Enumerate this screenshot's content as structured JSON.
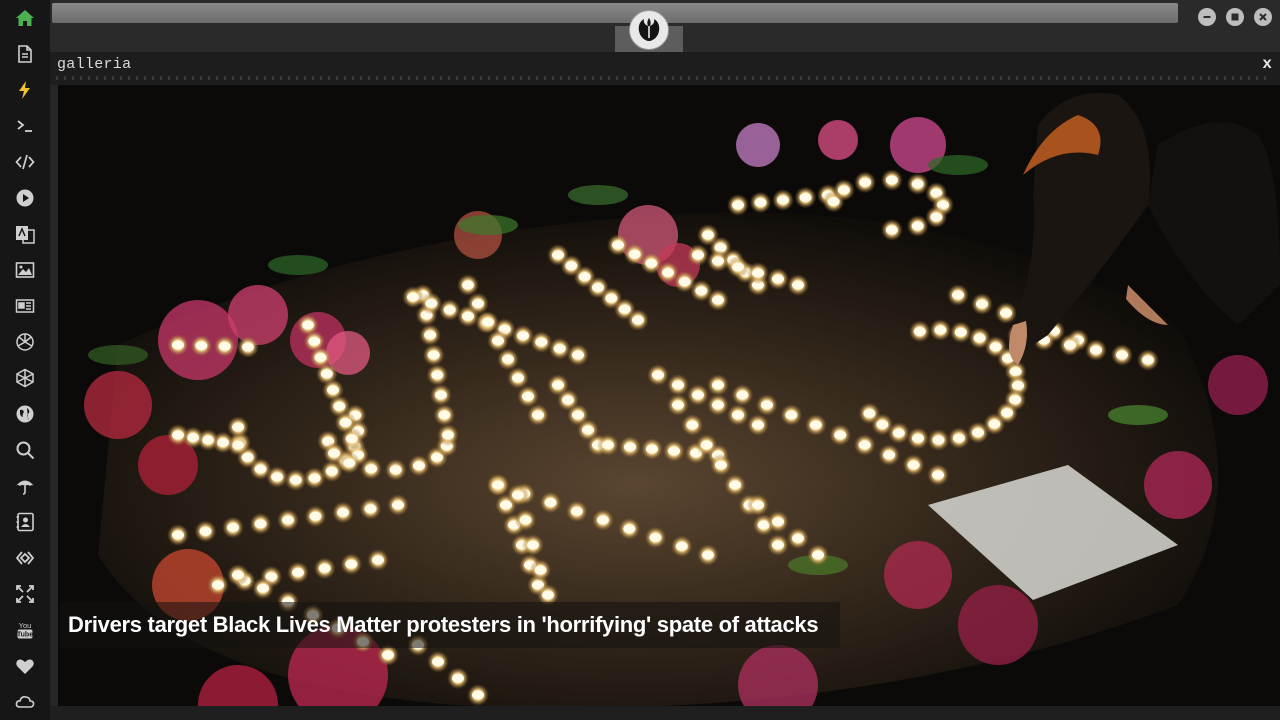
{
  "sidebar": {
    "accent_color": "#4caf50",
    "icon_color": "#cfcfcf",
    "items": [
      {
        "name": "home-icon"
      },
      {
        "name": "document-icon"
      },
      {
        "name": "lightning-icon"
      },
      {
        "name": "terminal-icon"
      },
      {
        "name": "code-icon"
      },
      {
        "name": "play-icon"
      },
      {
        "name": "translate-icon"
      },
      {
        "name": "image-icon"
      },
      {
        "name": "news-icon"
      },
      {
        "name": "aperture-icon"
      },
      {
        "name": "hexagon-icon"
      },
      {
        "name": "globe-icon"
      },
      {
        "name": "search-icon"
      },
      {
        "name": "umbrella-icon"
      },
      {
        "name": "contact-icon"
      },
      {
        "name": "transfer-icon"
      },
      {
        "name": "fullscreen-icon"
      },
      {
        "name": "youtube-icon"
      },
      {
        "name": "heart-icon"
      },
      {
        "name": "cloud-icon"
      }
    ]
  },
  "window": {
    "logo_icon": "rebel-alliance-icon"
  },
  "panel": {
    "title": "galleria",
    "close_label": "x"
  },
  "gallery": {
    "caption": "Drivers target Black Lives Matter protesters in 'horrifying' spate of attacks"
  }
}
